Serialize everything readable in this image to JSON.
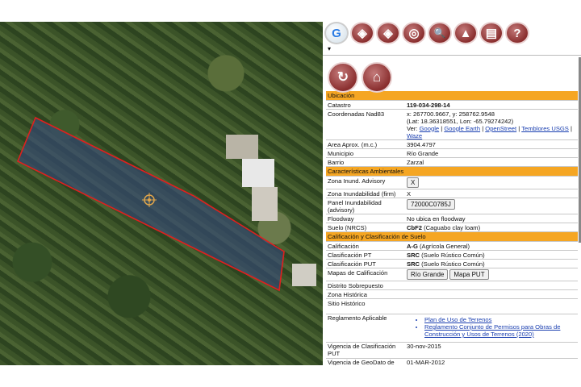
{
  "toolbar": {
    "items": [
      "G",
      "◈",
      "◈",
      "◎",
      "🔍",
      "▲",
      "▤",
      "?"
    ],
    "dropdown": "▾"
  },
  "bigicons": [
    "↻",
    "⌂"
  ],
  "sections": {
    "ubicacion": "Ubicación",
    "ambientales": "Características Ambientales",
    "calificacion": "Calificación y Clasificación de Suelo"
  },
  "ubicacion": {
    "catastro_label": "Catastro",
    "catastro_value": "119-034-298-14",
    "coord_label": "Coordenadas Nad83",
    "coord_xy": "x: 267700.9667, y: 258762.9548",
    "coord_latlon": "(Lat: 18.36318551, Lon: -65.79274242)",
    "ver_label": "Ver:",
    "links": [
      "Google",
      "Google Earth",
      "OpenStreet",
      "Temblores USGS",
      "Waze"
    ],
    "area_label": "Area Aprox. (m.c.)",
    "area_value": "3904.4797",
    "municipio_label": "Municipio",
    "municipio_value": "Río Grande",
    "barrio_label": "Barrio",
    "barrio_value": "Zarzal"
  },
  "ambientales": {
    "inund_adv_label": "Zona Inund. Advisory",
    "inund_adv_value": "X",
    "inund_firm_label": "Zona Inundabilidad (firm)",
    "inund_firm_value": "X",
    "panel_label": "Panel Inundabilidad (advisory)",
    "panel_value": "72000C0785J",
    "floodway_label": "Floodway",
    "floodway_value": "No ubica en floodway",
    "suelo_label": "Suelo (NRCS)",
    "suelo_code": "CbF2",
    "suelo_desc": " (Caguabo clay loam)"
  },
  "calificacion": {
    "calif_label": "Calificación",
    "calif_code": "A-G",
    "calif_desc": " (Agrícola General)",
    "pt_label": "Clasificación PT",
    "pt_code": "SRC",
    "pt_desc": " (Suelo Rústico Común)",
    "put_label": "Clasificación PUT",
    "put_code": "SRC",
    "put_desc": " (Suelo Rústico Común)",
    "mapas_label": "Mapas de Calificación",
    "mapas_buttons": [
      "Río Grande",
      "Mapa PUT"
    ],
    "sobrepuesto_label": "Distrito Sobrepuesto",
    "historica_label": "Zona Histórica",
    "sitio_label": "Sitio Histórico",
    "reglamento_label": "Reglamento Aplicable",
    "reglamento_items": [
      "Plan de Uso de Terrenos",
      "Reglamento Conjunto de Permisos para Obras de Construcción y Usos de Terrenos (2020)"
    ],
    "vigencia_put_label": "Vigencia de Clasificación PUT",
    "vigencia_put_value": "30-nov-2015",
    "vigencia_geo_label": "Vigencia de GeoDato de Calificación",
    "vigencia_geo_value": "01-MAR-2012"
  },
  "colors": {
    "section": "#f5a623",
    "parcel": "#e0201e",
    "link": "#1a3fb0"
  }
}
